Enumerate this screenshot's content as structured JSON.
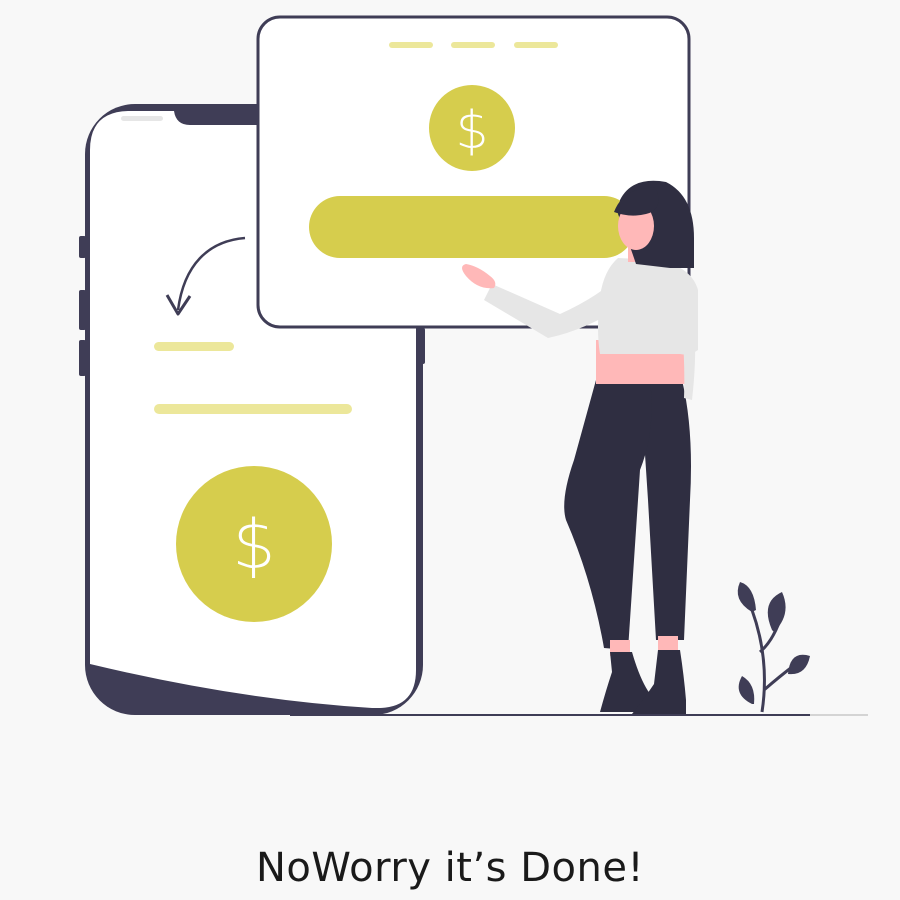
{
  "caption": "NoWorry it’s Done!",
  "phone_coin_symbol": "$",
  "card_coin_symbol": "$",
  "colors": {
    "background": "#f8f8f8",
    "accent": "#d6cd4d",
    "accent_light": "#ece79a",
    "dark": "#2f2e41",
    "skin": "#ffb8b8",
    "sweater": "#e6e6e6",
    "card": "#ffffff"
  },
  "icons": {
    "transfer_arrow": "curved-arrow-down-left-icon",
    "coin": "dollar-coin-icon",
    "plant": "plant-icon"
  }
}
